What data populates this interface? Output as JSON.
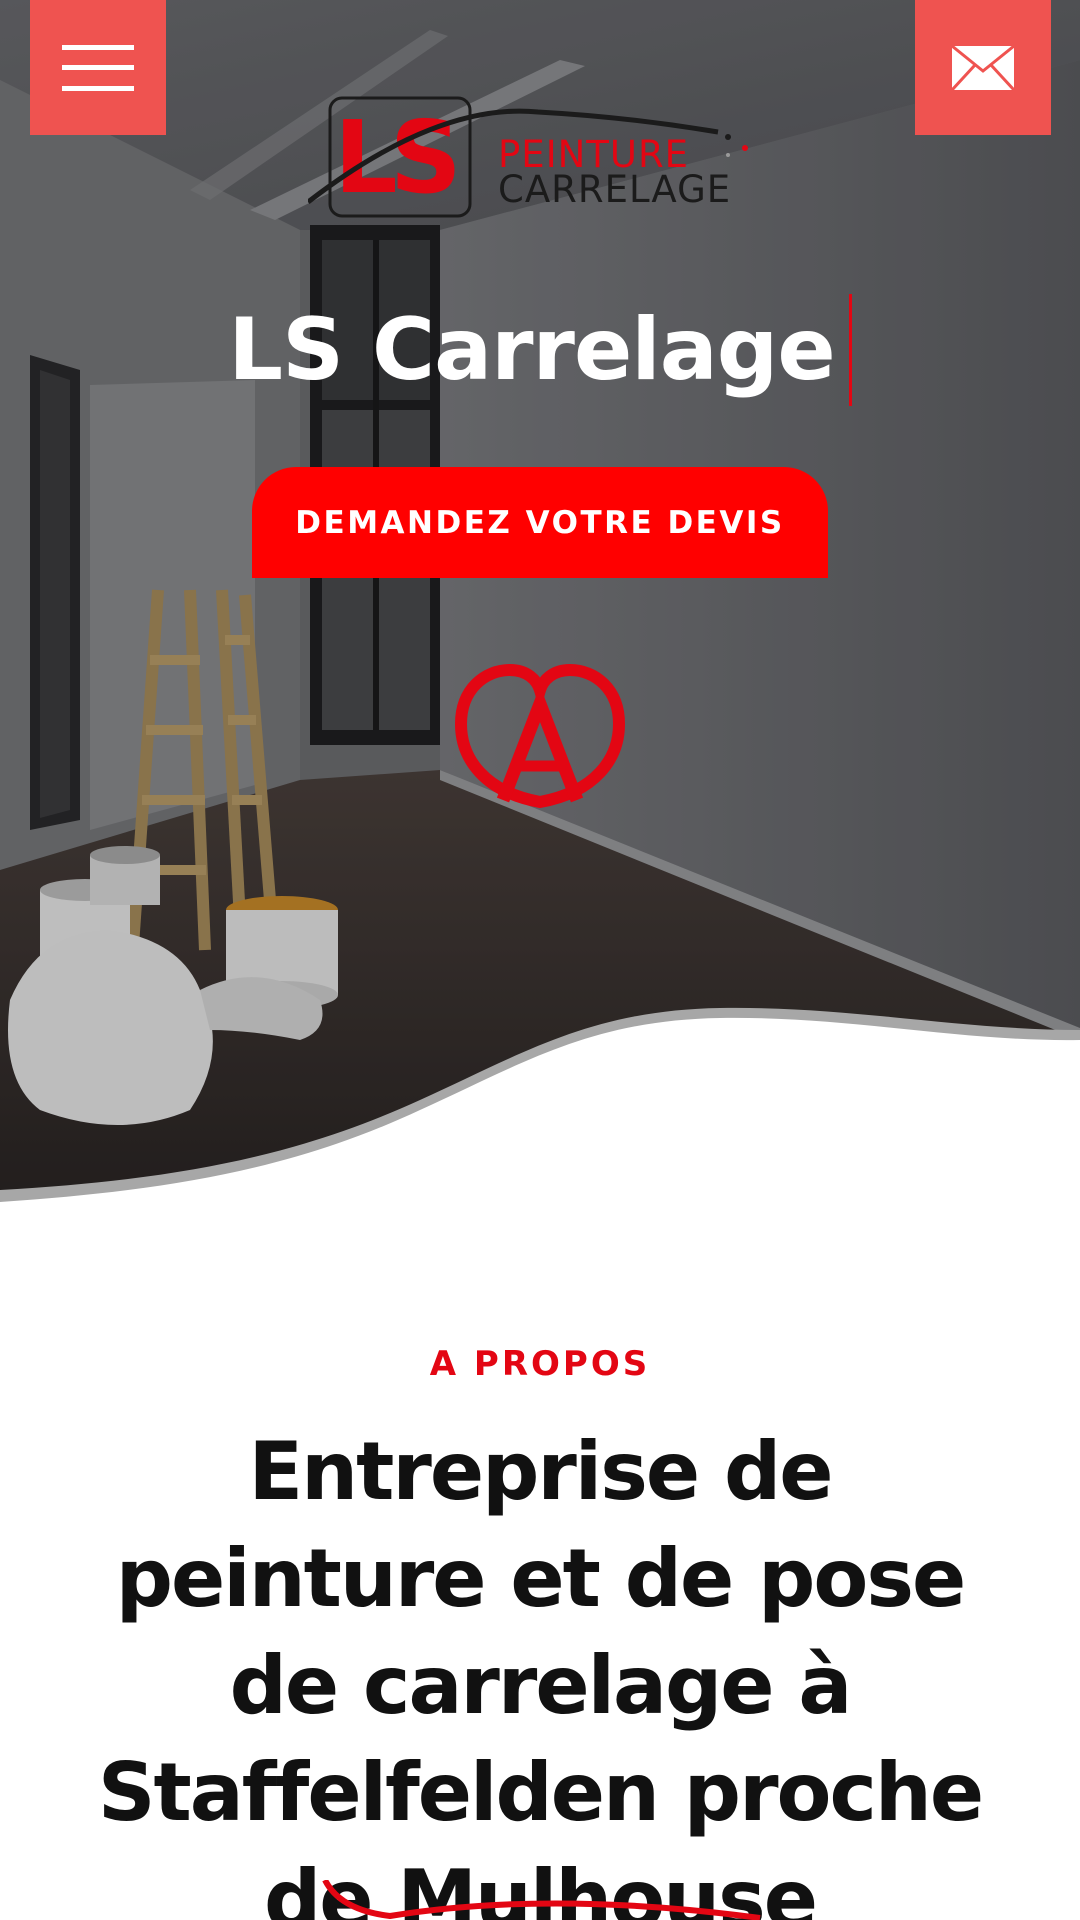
{
  "header": {
    "menu_icon": "hamburger-menu-icon",
    "mail_icon": "envelope-icon",
    "logo": {
      "mark": "LS",
      "line1": "PEINTURE",
      "line2": "CARRELAGE"
    }
  },
  "hero": {
    "title": "LS Carrelage",
    "cta_label": "DEMANDEZ VOTRE DEVIS",
    "emblem_icon": "alsace-heart-a-icon"
  },
  "about": {
    "kicker": "A PROPOS",
    "title": "Entreprise de peinture et de pose de carrelage à Staffelfelden proche de Mulhouse"
  },
  "colors": {
    "accent": "#ef5350",
    "cta": "#ff0000",
    "brand_red": "#e30613",
    "text": "#111111",
    "white": "#ffffff"
  }
}
